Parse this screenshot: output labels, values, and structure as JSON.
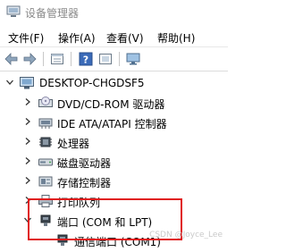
{
  "window": {
    "title": "设备管理器",
    "app_icon": "device-manager-icon"
  },
  "menu": {
    "items": [
      {
        "label": "文件(F)"
      },
      {
        "label": "操作(A)"
      },
      {
        "label": "查看(V)"
      },
      {
        "label": "帮助(H)"
      }
    ]
  },
  "toolbar": {
    "buttons": [
      "back-arrow-icon",
      "forward-arrow-icon",
      "properties-icon",
      "help-icon",
      "scan-hardware-icon",
      "monitor-icon"
    ]
  },
  "tree": {
    "root": {
      "label": "DESKTOP-CHGDSF5",
      "expanded": true,
      "icon": "computer-icon"
    },
    "nodes": [
      {
        "label": "DVD/CD-ROM 驱动器",
        "icon": "dvd-drive-icon",
        "expanded": false
      },
      {
        "label": "IDE ATA/ATAPI 控制器",
        "icon": "ide-controller-icon",
        "expanded": false
      },
      {
        "label": "处理器",
        "icon": "processor-icon",
        "expanded": false
      },
      {
        "label": "磁盘驱动器",
        "icon": "disk-drive-icon",
        "expanded": false
      },
      {
        "label": "存储控制器",
        "icon": "storage-controller-icon",
        "expanded": false
      },
      {
        "label": "打印队列",
        "icon": "printer-icon",
        "expanded": false
      },
      {
        "label": "端口 (COM 和 LPT)",
        "icon": "port-icon",
        "expanded": true
      }
    ],
    "child": {
      "label": "通信端口 (COM1)",
      "icon": "port-icon"
    }
  },
  "watermark": {
    "text": "CSDN @Joyce_Lee"
  },
  "colors": {
    "highlight": "#e01b1b",
    "title_text": "#8a8a8a"
  }
}
